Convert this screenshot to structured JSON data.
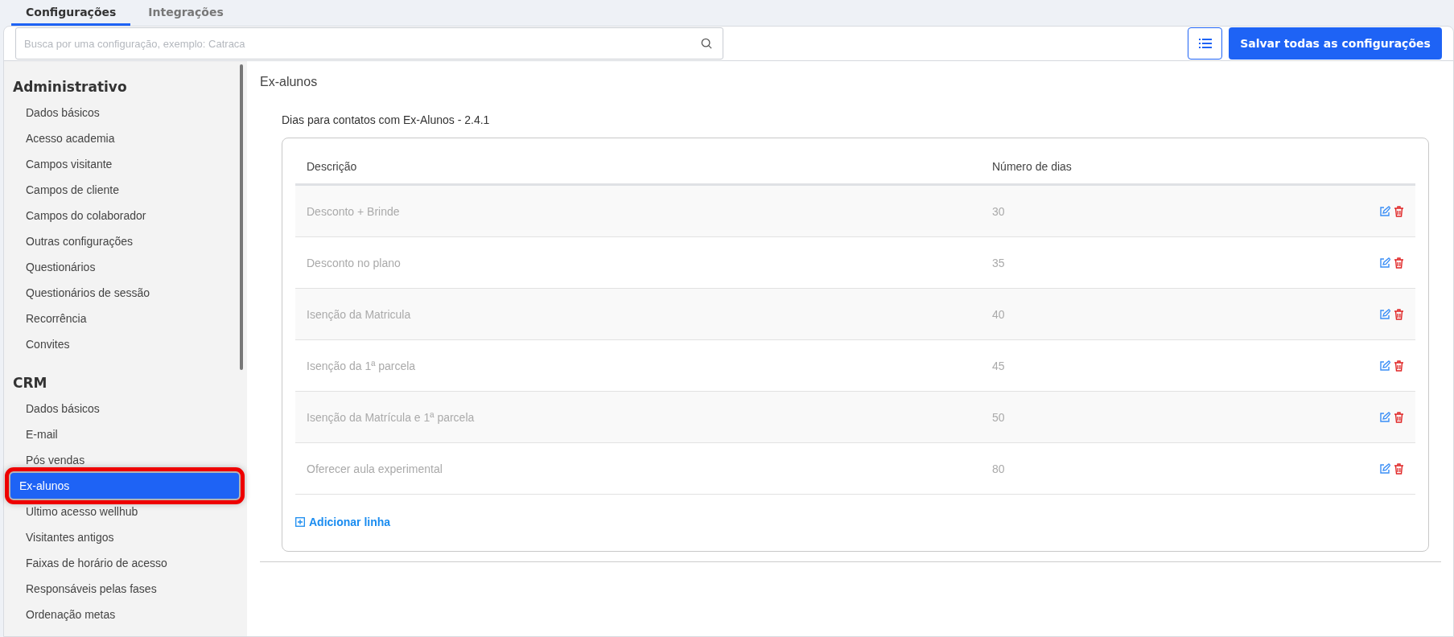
{
  "tabs": [
    {
      "label": "Configurações",
      "selected": true
    },
    {
      "label": "Integrações",
      "selected": false
    }
  ],
  "search": {
    "placeholder": "Busca por uma configuração, exemplo: Catraca"
  },
  "save_button": "Salvar todas as configurações",
  "sidebar": {
    "sections": [
      {
        "title": "Administrativo",
        "items": [
          {
            "label": "Dados básicos",
            "selected": false
          },
          {
            "label": "Acesso academia",
            "selected": false
          },
          {
            "label": "Campos visitante",
            "selected": false
          },
          {
            "label": "Campos de cliente",
            "selected": false
          },
          {
            "label": "Campos do colaborador",
            "selected": false
          },
          {
            "label": "Outras configurações",
            "selected": false
          },
          {
            "label": "Questionários",
            "selected": false
          },
          {
            "label": "Questionários de sessão",
            "selected": false
          },
          {
            "label": "Recorrência",
            "selected": false
          },
          {
            "label": "Convites",
            "selected": false
          }
        ]
      },
      {
        "title": "CRM",
        "items": [
          {
            "label": "Dados básicos",
            "selected": false
          },
          {
            "label": "E-mail",
            "selected": false
          },
          {
            "label": "Pós vendas",
            "selected": false
          },
          {
            "label": "Ex-alunos",
            "selected": true
          },
          {
            "label": "Ultimo acesso wellhub",
            "selected": false
          },
          {
            "label": "Visitantes antigos",
            "selected": false
          },
          {
            "label": "Faixas de horário de acesso",
            "selected": false
          },
          {
            "label": "Responsáveis pelas fases",
            "selected": false
          },
          {
            "label": "Ordenação metas",
            "selected": false
          }
        ]
      }
    ]
  },
  "page_title": "Ex-alunos",
  "section_title": "Dias para contatos com Ex-Alunos - 2.4.1",
  "table": {
    "columns": [
      "Descrição",
      "Número de dias"
    ],
    "rows": [
      {
        "description": "Desconto + Brinde",
        "days": "30"
      },
      {
        "description": "Desconto no plano",
        "days": "35"
      },
      {
        "description": "Isenção da Matricula",
        "days": "40"
      },
      {
        "description": "Isenção da 1ª parcela",
        "days": "45"
      },
      {
        "description": "Isenção da Matrícula e 1ª parcela",
        "days": "50"
      },
      {
        "description": "Oferecer aula experimental",
        "days": "80"
      }
    ]
  },
  "add_row": "Adicionar linha"
}
